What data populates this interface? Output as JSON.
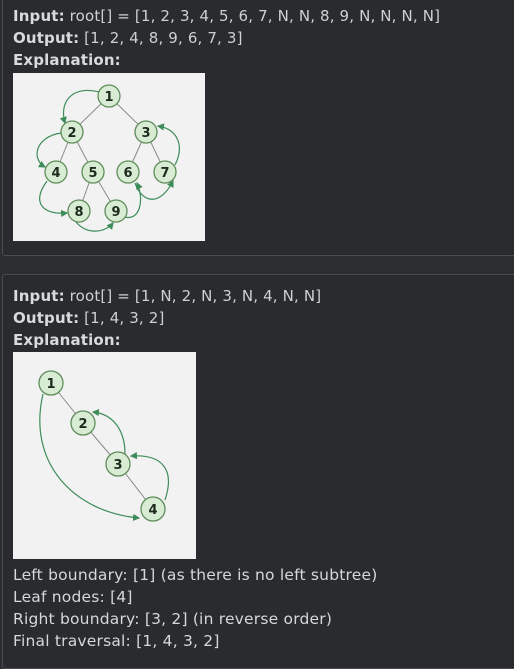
{
  "example1": {
    "input_label": "Input:",
    "input_value": "root[] = [1, 2, 3, 4, 5, 6, 7, N, N, 8, 9, N, N, N, N]",
    "output_label": "Output:",
    "output_value": "[1, 2, 4, 8, 9, 6, 7, 3]",
    "explanation_label": "Explanation:",
    "nodes": [
      "1",
      "2",
      "3",
      "4",
      "5",
      "6",
      "7",
      "8",
      "9"
    ]
  },
  "example2": {
    "input_label": "Input:",
    "input_value": "root[] = [1, N, 2, N, 3, N, 4, N, N]",
    "output_label": "Output:",
    "output_value": "[1, 4, 3, 2]",
    "explanation_label": "Explanation:",
    "nodes": [
      "1",
      "2",
      "3",
      "4"
    ],
    "explanation_lines": [
      "Left boundary: [1] (as there is no left subtree)",
      "Leaf nodes: [4]",
      "Right boundary: [3, 2] (in reverse order)",
      "Final traversal: [1, 4, 3, 2]"
    ]
  },
  "colors": {
    "background": "#2b2d31",
    "card_border": "#4a4c52",
    "node_fill": "#d8ecd3",
    "node_stroke": "#5f8c5a",
    "arrow": "#3e8c5a",
    "diagram_bg": "#f2f2f2"
  }
}
